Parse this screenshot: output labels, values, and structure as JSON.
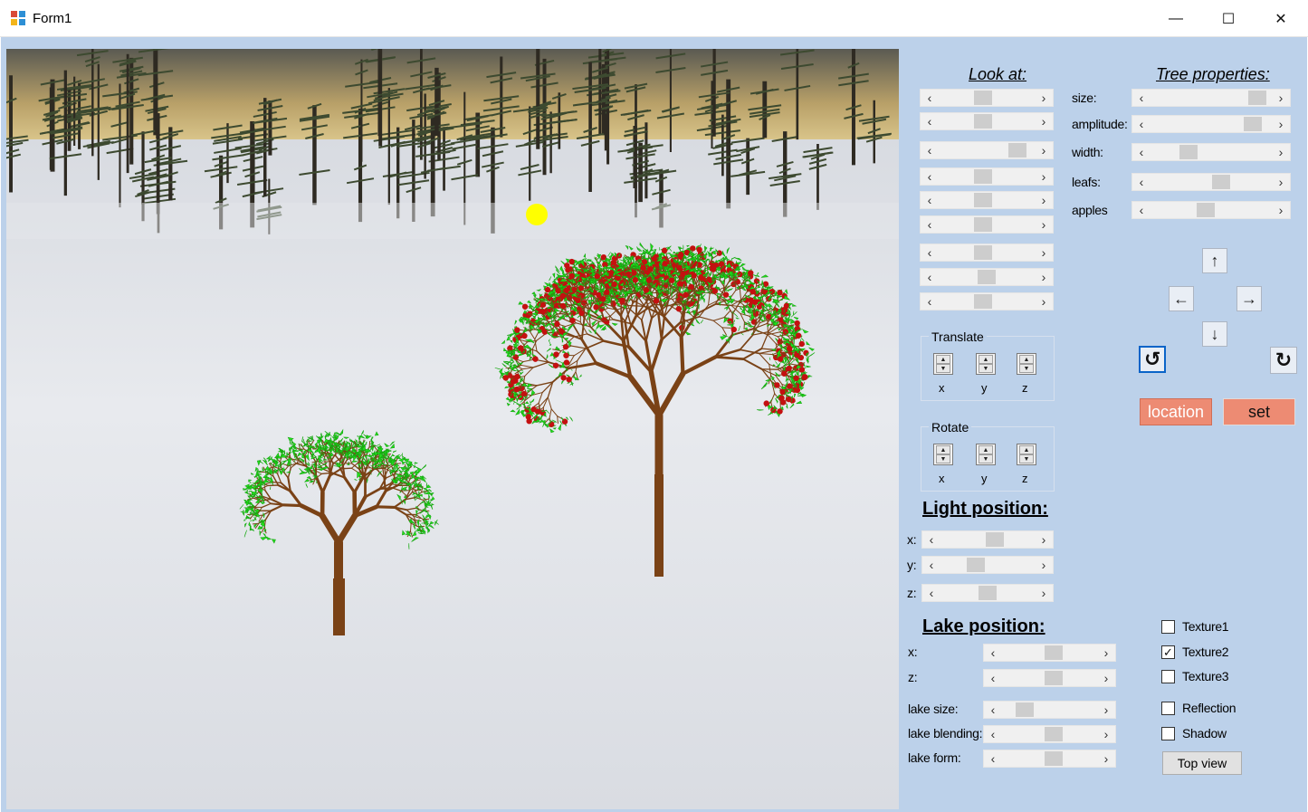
{
  "window": {
    "title": "Form1",
    "minimize_glyph": "—",
    "maximize_glyph": "☐",
    "close_glyph": "✕"
  },
  "look_at": {
    "title": "Look at:",
    "sliders": [
      0.45,
      0.45,
      0.9,
      0.45,
      0.45,
      0.45,
      0.45,
      0.5,
      0.45
    ]
  },
  "tree_properties": {
    "title": "Tree properties:",
    "rows": [
      {
        "label": "size:",
        "value": 0.95
      },
      {
        "label": "amplitude:",
        "value": 0.9
      },
      {
        "label": "width:",
        "value": 0.28
      },
      {
        "label": "leafs:",
        "value": 0.6
      },
      {
        "label": "apples",
        "value": 0.45
      }
    ]
  },
  "translate": {
    "title": "Translate",
    "axes": [
      "x",
      "y",
      "z"
    ]
  },
  "rotate": {
    "title": "Rotate",
    "axes": [
      "x",
      "y",
      "z"
    ]
  },
  "light_position": {
    "title": "Light position:",
    "rows": [
      {
        "label": "x:",
        "value": 0.6
      },
      {
        "label": "y:",
        "value": 0.35
      },
      {
        "label": "z:",
        "value": 0.5
      }
    ]
  },
  "lake_position": {
    "title": "Lake position:",
    "rows": [
      {
        "label": "x:",
        "value": 0.55
      },
      {
        "label": "z:",
        "value": 0.55
      },
      {
        "label": "lake size:",
        "value": 0.18
      },
      {
        "label": "lake blending:",
        "value": 0.55
      },
      {
        "label": "lake form:",
        "value": 0.55
      }
    ]
  },
  "nav": {
    "up": "↑",
    "left": "←",
    "right": "→",
    "down": "↓",
    "rotate_left": "↻",
    "rotate_right": "↻"
  },
  "buttons": {
    "location": "location",
    "set": "set",
    "top_view": "Top view"
  },
  "options": [
    {
      "label": "Texture1",
      "checked": false
    },
    {
      "label": "Texture2",
      "checked": true
    },
    {
      "label": "Texture3",
      "checked": false
    },
    {
      "label": "Reflection",
      "checked": false
    },
    {
      "label": "Shadow",
      "checked": false
    }
  ],
  "scrollbar": {
    "left_arrow": "‹",
    "right_arrow": "›"
  },
  "spinner": {
    "up": "▲",
    "down": "▼"
  },
  "check_glyph": "✓",
  "colors": {
    "panel_bg": "#bcd1ea",
    "button_salmon": "#ed8b73",
    "leaf_green": "#22e01c",
    "apple_red": "#c41010",
    "trunk_brown": "#7a4216",
    "sun_yellow": "#ffff00"
  }
}
